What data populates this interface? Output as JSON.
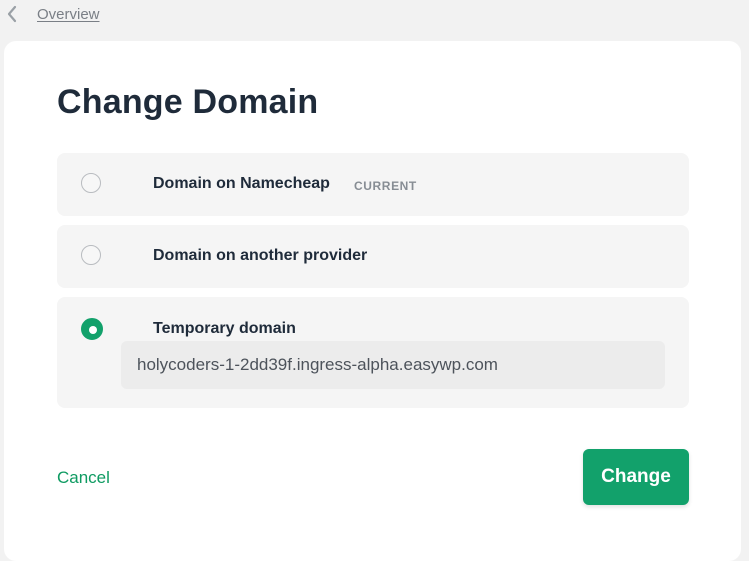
{
  "breadcrumb": {
    "back_label": "Overview",
    "back_icon": "chevron-left-icon"
  },
  "dialog": {
    "title": "Change Domain",
    "options": [
      {
        "label": "Domain on Namecheap",
        "badge": "CURRENT",
        "selected": false
      },
      {
        "label": "Domain on another provider",
        "selected": false
      },
      {
        "label": "Temporary domain",
        "selected": true,
        "value": "holycoders-1-2dd39f.ingress-alpha.easywp.com"
      }
    ],
    "cancel_label": "Cancel",
    "submit_label": "Change"
  },
  "colors": {
    "accent": "#12a16b",
    "link": "#0f9b62",
    "text": "#1f2b3a",
    "muted": "#878d94",
    "option_bg": "#f5f5f5",
    "page_bg": "#f2f2f2"
  }
}
